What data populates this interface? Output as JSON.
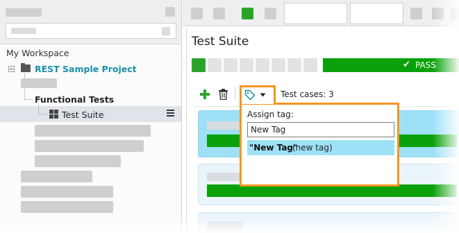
{
  "navigator": {
    "workspace_label": "My Workspace",
    "project_label": "REST Sample Project",
    "functional_tests_label": "Functional Tests",
    "test_suite_label": "Test Suite"
  },
  "editor": {
    "title": "Test Suite",
    "run_status": "PASS",
    "test_cases_count_label": "Test cases: 3"
  },
  "tag_popup": {
    "assign_label": "Assign tag:",
    "input_value": "New Tag",
    "suggestion_name": "\"New Tag\"",
    "suggestion_note": "(new tag)"
  },
  "colors": {
    "accent_orange": "#f7941d",
    "pass_green": "#0aa10a",
    "project_teal": "#1a8ea8",
    "selection_blue": "#9ee1f7"
  },
  "icons": [
    "folder-icon",
    "test-suite-grid-icon",
    "menu-icon",
    "plus-icon",
    "trash-icon",
    "tag-icon",
    "chevron-down-icon",
    "check-icon"
  ]
}
